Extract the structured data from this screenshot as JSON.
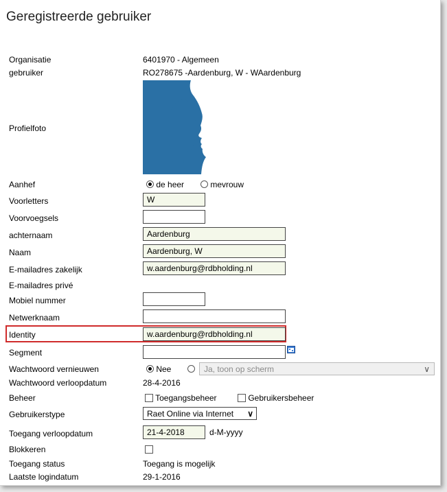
{
  "title": "Geregistreerde gebruiker",
  "organisatie": {
    "label": "Organisatie",
    "value": "6401970 - Algemeen"
  },
  "gebruiker": {
    "label": "gebruiker",
    "value": "RO278675 -Aardenburg, W  - WAardenburg"
  },
  "profielfoto": {
    "label": "Profielfoto"
  },
  "aanhef": {
    "label": "Aanhef",
    "options": [
      "de heer",
      "mevrouw"
    ],
    "selected": "de heer"
  },
  "voorletters": {
    "label": "Voorletters",
    "value": "W"
  },
  "voorvoegsels": {
    "label": "Voorvoegsels",
    "value": ""
  },
  "achternaam": {
    "label": "achternaam",
    "value": "Aardenburg"
  },
  "naam": {
    "label": "Naam",
    "value": "Aardenburg, W"
  },
  "email_zakelijk": {
    "label": "E-mailadres zakelijk",
    "value": "w.aardenburg@rdbholding.nl"
  },
  "email_prive": {
    "label": "E-mailadres privé",
    "value": ""
  },
  "mobiel": {
    "label": "Mobiel nummer",
    "value": ""
  },
  "netwerknaam": {
    "label": "Netwerknaam",
    "value": ""
  },
  "identity": {
    "label": "Identity",
    "value": "w.aardenburg@rdbholding.nl"
  },
  "segment": {
    "label": "Segment",
    "value": ""
  },
  "wachtwoord_vernieuwen": {
    "label": "Wachtwoord vernieuwen",
    "options": [
      "Nee",
      ""
    ],
    "selected": "Nee",
    "select_value": "Ja, toon op scherm"
  },
  "wachtwoord_verloopdatum": {
    "label": "Wachtwoord verloopdatum",
    "value": "28-4-2016"
  },
  "beheer": {
    "label": "Beheer",
    "options": [
      "Toegangsbeheer",
      "Gebruikersbeheer"
    ]
  },
  "gebruikerstype": {
    "label": "Gebruikerstype",
    "value": "Raet Online via Internet"
  },
  "toegang_verloopdatum": {
    "label": "Toegang verloopdatum",
    "value": "21-4-2018",
    "format": "d-M-yyyy"
  },
  "blokkeren": {
    "label": "Blokkeren"
  },
  "toegang_status": {
    "label": "Toegang status",
    "value": "Toegang is mogelijk"
  },
  "laatste_logindatum": {
    "label": "Laatste logindatum",
    "value": "29-1-2016"
  },
  "colors": {
    "accent": "#2a70a5",
    "highlight": "#cf2a2a",
    "field_filled": "#f4f8ea"
  },
  "icons": {
    "calendar": "calendar-icon",
    "chevron": "chevron-down-icon"
  }
}
